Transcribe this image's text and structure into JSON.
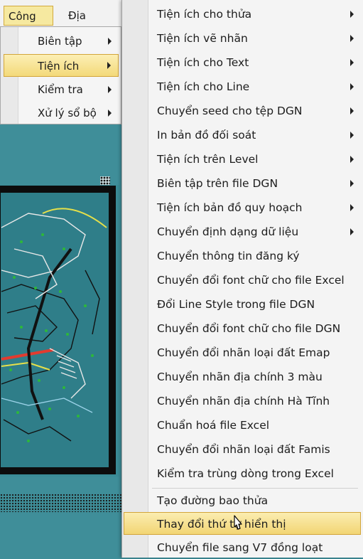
{
  "menubar": {
    "items": [
      {
        "label": "Công cụ",
        "active": true
      },
      {
        "label": "Địa chính",
        "active": false
      }
    ]
  },
  "menu1": {
    "items": [
      {
        "label": "Biên tập",
        "submenu": true,
        "highlighted": false
      },
      {
        "label": "Tiện ích",
        "submenu": true,
        "highlighted": true
      },
      {
        "label": "Kiểm tra",
        "submenu": true,
        "highlighted": false
      },
      {
        "label": "Xử lý sổ bộ",
        "submenu": true,
        "highlighted": false
      }
    ]
  },
  "menu2": {
    "items": [
      {
        "label": "Tiện ích cho thửa",
        "submenu": true
      },
      {
        "label": "Tiện ích vẽ nhãn",
        "submenu": true
      },
      {
        "label": "Tiện ích cho Text",
        "submenu": true
      },
      {
        "label": "Tiện ích cho Line",
        "submenu": true
      },
      {
        "label": "Chuyển seed cho tệp DGN",
        "submenu": true
      },
      {
        "label": "In bản đồ đối soát",
        "submenu": true
      },
      {
        "label": "Tiện ích trên Level",
        "submenu": true
      },
      {
        "label": "Biên tập trên file DGN",
        "submenu": true
      },
      {
        "label": "Tiện ích bản đồ quy hoạch",
        "submenu": true
      },
      {
        "label": "Chuyển định dạng dữ liệu",
        "submenu": true
      },
      {
        "label": "Chuyển thông tin đăng ký",
        "submenu": false
      },
      {
        "label": "Chuyển đổi font chữ cho file Excel",
        "submenu": false
      },
      {
        "label": "Đổi Line Style trong file DGN",
        "submenu": false
      },
      {
        "label": "Chuyển đổi font chữ cho file DGN",
        "submenu": false
      },
      {
        "label": "Chuyển đổi nhãn loại đất Emap",
        "submenu": false
      },
      {
        "label": "Chuyển nhãn địa chính 3 màu",
        "submenu": false
      },
      {
        "label": "Chuyển nhãn địa chính Hà Tĩnh",
        "submenu": false
      },
      {
        "label": "Chuẩn hoá file Excel",
        "submenu": false
      },
      {
        "label": "Chuyển đổi nhãn loại đất Famis",
        "submenu": false
      },
      {
        "label": "Kiểm tra trùng dòng trong Excel",
        "submenu": false
      },
      {
        "label": "Tạo đường bao thửa",
        "submenu": false
      },
      {
        "label": "Thay đổi thứ tự hiển thị",
        "submenu": false,
        "highlighted": true
      },
      {
        "label": "Chuyển file sang V7 đồng loạt",
        "submenu": false
      }
    ]
  },
  "colors": {
    "workspace": "#3f8e99",
    "menu_background": "#f4f4f4",
    "highlight": "#f3d97a",
    "highlight_border": "#d2a53a"
  }
}
